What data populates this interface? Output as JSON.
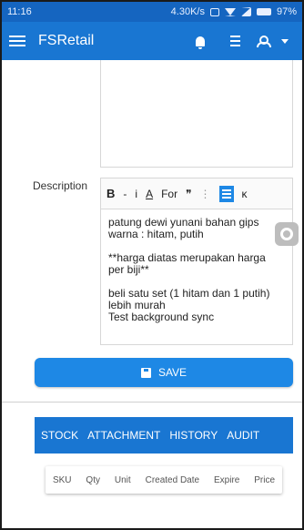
{
  "status_bar": {
    "time": "11:16",
    "net_speed": "4.30K/s",
    "battery": "97%"
  },
  "appbar": {
    "title": "FSRetail"
  },
  "description": {
    "label": "Description",
    "lines": [
      "patung dewi yunani bahan gips",
      "warna : hitam, putih",
      "",
      "**harga diatas merupakan harga",
      "per biji**",
      "",
      "beli satu set (1 hitam dan 1 putih)",
      "lebih murah",
      "Test background sync"
    ]
  },
  "toolbar": {
    "bold": "B",
    "dash": "-",
    "italic": "i",
    "font_color": "A",
    "font_label": "For",
    "quote": "❞",
    "more": "⋮",
    "overflow": "ĸ"
  },
  "save_button": {
    "label": "SAVE"
  },
  "tabs": [
    "STOCK",
    "ATTACHMENT",
    "HISTORY",
    "AUDIT"
  ],
  "table": {
    "columns": [
      "SKU",
      "Qty",
      "Unit",
      "Created Date",
      "Expire",
      "Price"
    ]
  },
  "colors": {
    "primary": "#1976d2",
    "button": "#1e88e5",
    "statusbar": "#1565c0"
  },
  "icons": [
    "menu-icon",
    "bell-icon",
    "tasks-icon",
    "user-icon",
    "chevron-down-icon",
    "settings-icon",
    "save-icon"
  ]
}
